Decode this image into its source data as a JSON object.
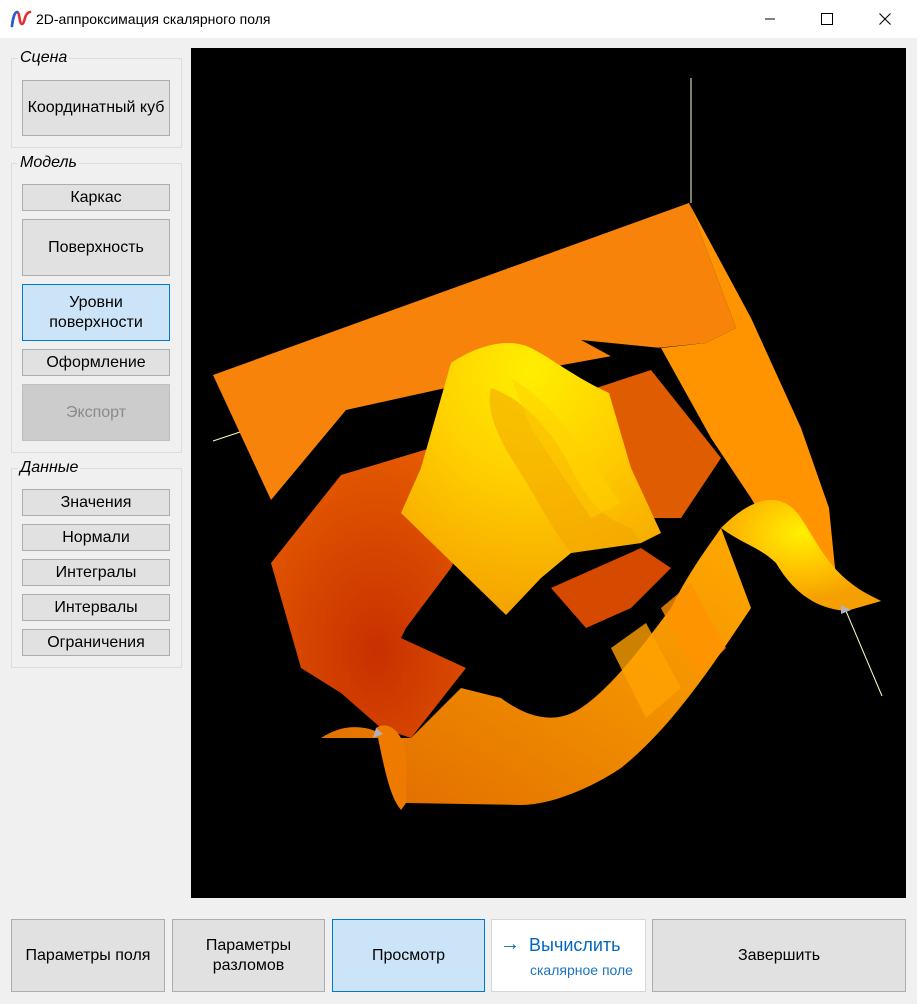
{
  "window": {
    "title": "2D-аппроксимация скалярного поля",
    "controls": [
      "minimize",
      "maximize",
      "close"
    ]
  },
  "sidebar": {
    "scene": {
      "title": "Сцена",
      "buttons": [
        {
          "label": "Координатный куб",
          "state": "normal"
        }
      ]
    },
    "model": {
      "title": "Модель",
      "buttons": [
        {
          "label": "Каркас",
          "state": "normal"
        },
        {
          "label": "Поверхность",
          "state": "normal"
        },
        {
          "label": "Уровни поверхности",
          "state": "selected"
        },
        {
          "label": "Оформление",
          "state": "normal"
        },
        {
          "label": "Экспорт",
          "state": "disabled"
        }
      ]
    },
    "data": {
      "title": "Данные",
      "buttons": [
        {
          "label": "Значения",
          "state": "normal"
        },
        {
          "label": "Нормали",
          "state": "normal"
        },
        {
          "label": "Интегралы",
          "state": "normal"
        },
        {
          "label": "Интервалы",
          "state": "normal"
        },
        {
          "label": "Ограничения",
          "state": "normal"
        }
      ]
    }
  },
  "viewport": {
    "content": "3D surface with level bands",
    "background": "#000000",
    "colors": [
      "#ff8c00",
      "#ffd400",
      "#f07800",
      "#e05a10",
      "#d84800"
    ]
  },
  "bottom_bar": {
    "field_params": "Параметры поля",
    "fault_params": "Параметры разломов",
    "preview": "Просмотр",
    "compute": {
      "label": "Вычислить",
      "sub": "скалярное поле",
      "icon": "arrow-right-icon"
    },
    "finish": "Завершить"
  },
  "colors": {
    "accent": "#0078d7",
    "selected_bg": "#cce4f7",
    "link": "#0067c0"
  }
}
